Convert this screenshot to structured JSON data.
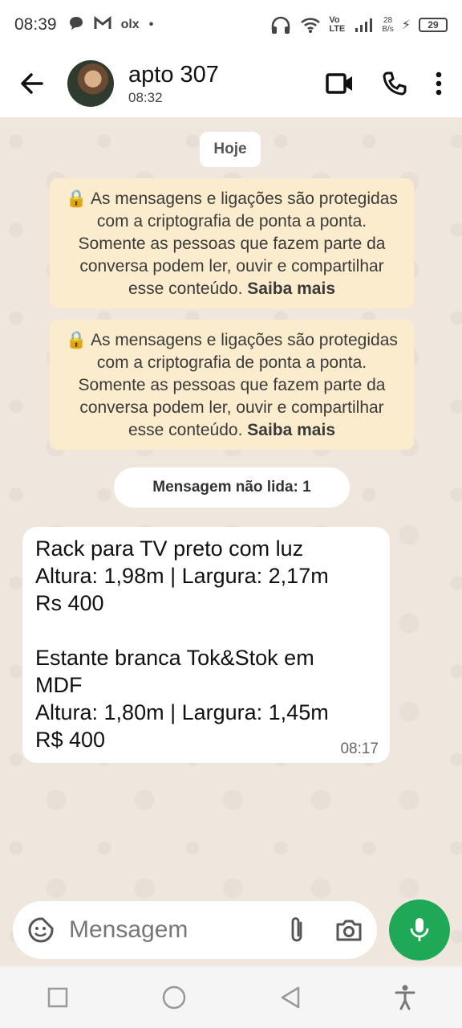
{
  "status_bar": {
    "time": "08:39",
    "left_icons": [
      "chat-bubble-icon",
      "gmail-icon",
      "olx-icon",
      "dot-icon"
    ],
    "olx_text": "olx",
    "network_speed": "28",
    "network_unit": "B/s",
    "volte": "Vo LTE",
    "battery": "29"
  },
  "header": {
    "contact_name": "apto 307",
    "last_seen": "08:32"
  },
  "chat": {
    "day_label": "Hoje",
    "notice_text": "As mensagens e ligações são protegidas com a criptografia de ponta a ponta. Somente as pessoas que fazem parte da conversa podem ler, ouvir e compartilhar esse conteúdo.",
    "notice_link": "Saiba mais",
    "unread_label": "Mensagem não lida: 1",
    "message": {
      "lines": [
        "Rack para TV preto com luz",
        "Altura: 1,98m | Largura: 2,17m",
        "Rs 400",
        "",
        "Estante branca Tok&Stok em",
        "MDF",
        "Altura: 1,80m | Largura: 1,45m",
        "R$ 400"
      ],
      "time": "08:17"
    }
  },
  "input": {
    "placeholder": "Mensagem"
  },
  "colors": {
    "notice_bg": "#fcecce",
    "mic_green": "#1fa855",
    "chat_bg": "#efe7dd"
  }
}
